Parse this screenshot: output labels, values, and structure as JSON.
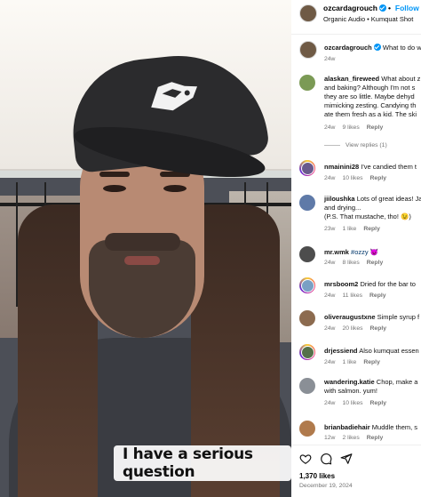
{
  "post": {
    "username": "ozcardagrouch",
    "follow_label": "Follow",
    "audio": "Organic Audio",
    "location": "Kumquat Shot",
    "caption_text": "What to do w",
    "caption_time": "24w",
    "video_caption": "I have a serious question"
  },
  "comments": [
    {
      "username": "alaskan_fireweed",
      "text": [
        "What about z",
        "and baking? Although I'm not s",
        "they are so little. Maybe dehyd",
        "mimicking zesting. Candying th",
        "ate them fresh as a kid. The ski"
      ],
      "time": "24w",
      "likes": "9 likes",
      "reply": "Reply",
      "view_replies": "View replies (1)",
      "avatar_color": "#7b9a55"
    },
    {
      "username": "nmainini28",
      "text": [
        "I've candied them t"
      ],
      "time": "24w",
      "likes": "10 likes",
      "reply": "Reply",
      "avatar_color": "#6a5a8c"
    },
    {
      "username": "jiiloushka",
      "text": [
        "Lots of great ideas! Ja",
        "and drying...",
        "(P.S. That mustache, tho! 😉)"
      ],
      "time": "23w",
      "likes": "1 like",
      "reply": "Reply",
      "avatar_color": "#5f7aa8"
    },
    {
      "username": "mr.wmk",
      "hashtag": "#ozzy",
      "emoji": "😈",
      "time": "24w",
      "likes": "8 likes",
      "reply": "Reply",
      "avatar_color": "#4d4d4d"
    },
    {
      "username": "mrsboom2",
      "text": [
        "Dried for the bar to"
      ],
      "time": "24w",
      "likes": "11 likes",
      "reply": "Reply",
      "avatar_color": "#7aa0c4"
    },
    {
      "username": "oliveraugustxne",
      "text": [
        "Simple syrup f"
      ],
      "time": "24w",
      "likes": "20 likes",
      "reply": "Reply",
      "avatar_color": "#8c6b4f"
    },
    {
      "username": "drjessiend",
      "text": [
        "Also kumquat essen"
      ],
      "time": "24w",
      "likes": "1 like",
      "reply": "Reply",
      "avatar_color": "#55704a"
    },
    {
      "username": "wandering.katie",
      "text": [
        "Chop, make a",
        "with salmon. yum!"
      ],
      "time": "24w",
      "likes": "10 likes",
      "reply": "Reply",
      "avatar_color": "#8a8f96"
    },
    {
      "username": "brianbadiehair",
      "text": [
        "Muddle them, s"
      ],
      "time": "12w",
      "likes": "2 likes",
      "reply": "Reply",
      "avatar_color": "#b07a4c"
    }
  ],
  "footer": {
    "likes": "1,370 likes",
    "date": "December 19, 2024",
    "icons": [
      "heart-icon",
      "comment-icon",
      "share-icon"
    ]
  },
  "colors": {
    "accent": "#0095f6",
    "meta": "#737373",
    "hashtag": "#00376b"
  }
}
